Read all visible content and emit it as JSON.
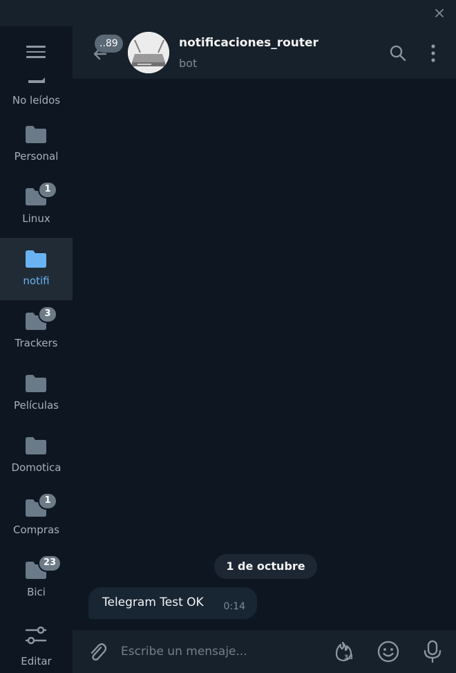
{
  "sidebar": {
    "folders": [
      {
        "label": "No leídos",
        "badge": ""
      },
      {
        "label": "Personal",
        "badge": ""
      },
      {
        "label": "Linux",
        "badge": "1"
      },
      {
        "label": "notifi",
        "badge": ""
      },
      {
        "label": "Trackers",
        "badge": "3"
      },
      {
        "label": "Películas",
        "badge": ""
      },
      {
        "label": "Domotica",
        "badge": ""
      },
      {
        "label": "Compras",
        "badge": "1"
      },
      {
        "label": "Bici",
        "badge": "23"
      }
    ],
    "edit_label": "Editar",
    "active_index": 3
  },
  "header": {
    "back_badge": "..89",
    "title": "notificaciones_router",
    "subtitle": "bot"
  },
  "messages": {
    "date_separator": "1 de octubre",
    "items": [
      {
        "text": "Telegram Test OK",
        "time": "0:14"
      }
    ]
  },
  "composer": {
    "placeholder": "Escribe un mensaje..."
  },
  "colors": {
    "accent": "#6ab3f3",
    "background": "#0e1621",
    "panel": "#17212b",
    "badge": "#6d7a87"
  }
}
